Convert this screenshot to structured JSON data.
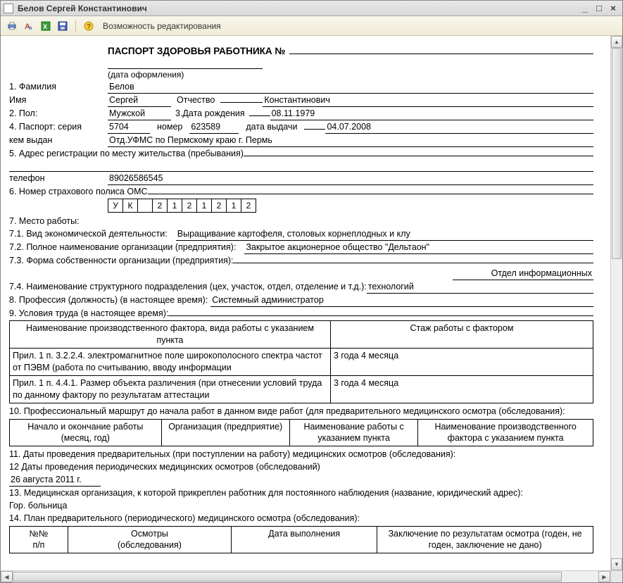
{
  "window": {
    "title": "Белов Сергей Константинович"
  },
  "toolbar": {
    "edit_mode": "Возможность редактирования"
  },
  "doc": {
    "title": "ПАСПОРТ ЗДОРОВЬЯ РАБОТНИКА №",
    "date_label": "(дата оформления)",
    "l_surname": "1. Фамилия",
    "surname": "Белов",
    "l_name": "Имя",
    "name": "Сергей",
    "l_patronymic": "Отчество",
    "patronymic": "Константинович",
    "l_sex": "2. Пол:",
    "sex": "Мужской",
    "l_dob": "3.Дата рождения",
    "dob": "08.11.1979",
    "l_passport": "4. Паспорт: серия",
    "pass_series": "5704",
    "l_pass_num": "номер",
    "pass_num": "623589",
    "l_pass_date": "дата выдачи",
    "pass_date": "04.07.2008",
    "l_issued": "кем выдан",
    "issued_by": "Отд.УФМС по Пермскому краю г. Пермь",
    "l_address": "5. Адрес регистрации по месту жительства (пребывания)",
    "l_phone": "телефон",
    "phone": "89026586545",
    "l_oms": "6. Номер страхового полиса ОМС",
    "oms": [
      "У",
      "К",
      "",
      "2",
      "1",
      "2",
      "1",
      "2",
      "1",
      "2"
    ],
    "l_workplace": "7. Место работы:",
    "l_activity": "7.1. Вид экономической деятельности:",
    "activity": "Выращивание картофеля, столовых корнеплодных и клу",
    "l_orgname": "7.2. Полное наименование организации (предприятия):",
    "orgname": "Закрытое акционерное общество \"Дельтаон\"",
    "l_ownership": "7.3. Форма собственности организации (предприятия):",
    "l_department": "7.4. Наименование структурного подразделения (цех, участок, отдел, отделение и т.д.):",
    "department": "Отдел информационных технологий",
    "l_profession": "8. Профессия (должность) (в настоящее время):",
    "profession": "Системный администратор",
    "l_conditions": "9. Условия труда (в настоящее время):",
    "tbl9": {
      "h1": "Наименование производственного фактора, вида работы с указанием пункта",
      "h2": "Стаж работы с фактором",
      "r1c1": "Прил. 1 п. 3.2.2.4. электромагнитное поле широкополосного спектра частот от ПЭВМ (работа по считыванию, вводу информации",
      "r1c2": "3 года 4 месяца",
      "r2c1": "Прил. 1 п. 4.4.1. Размер объекта различения (при отнесении условий труда по данному фактору по результатам аттестации",
      "r2c2": "3 года 4 месяца"
    },
    "l_route": "10. Профессиональный маршрут до начала работ в данном виде работ (для предварительного медицинского осмотра (обследования):",
    "tbl10": {
      "h1": "Начало и окончание работы (месяц, год)",
      "h2": "Организация (предприятие)",
      "h3": "Наименование работы с указанием пункта",
      "h4": "Наименование производственного фактора с указанием пункта"
    },
    "l_prelim": "11. Даты проведения предварительных (при поступлении на работу) медицинских осмотров (обследования):",
    "l_periodic": "12 Даты проведения периодических медицинских осмотров (обследований)",
    "periodic_date": "26 августа 2011 г.",
    "l_medorg": "13. Медицинская организация, к которой прикреплен работник для постоянного наблюдения (название, юридический адрес):",
    "medorg": "Гор. больница",
    "l_plan": "14. План предварительного (периодического) медицинского осмотра (обследования):",
    "tbl14": {
      "h1": "№№\nп/п",
      "h2": "Осмотры\n(обследования)",
      "h3": "Дата выполнения",
      "h4": "Заключение по результатам осмотра (годен, не годен, заключение не дано)"
    }
  }
}
